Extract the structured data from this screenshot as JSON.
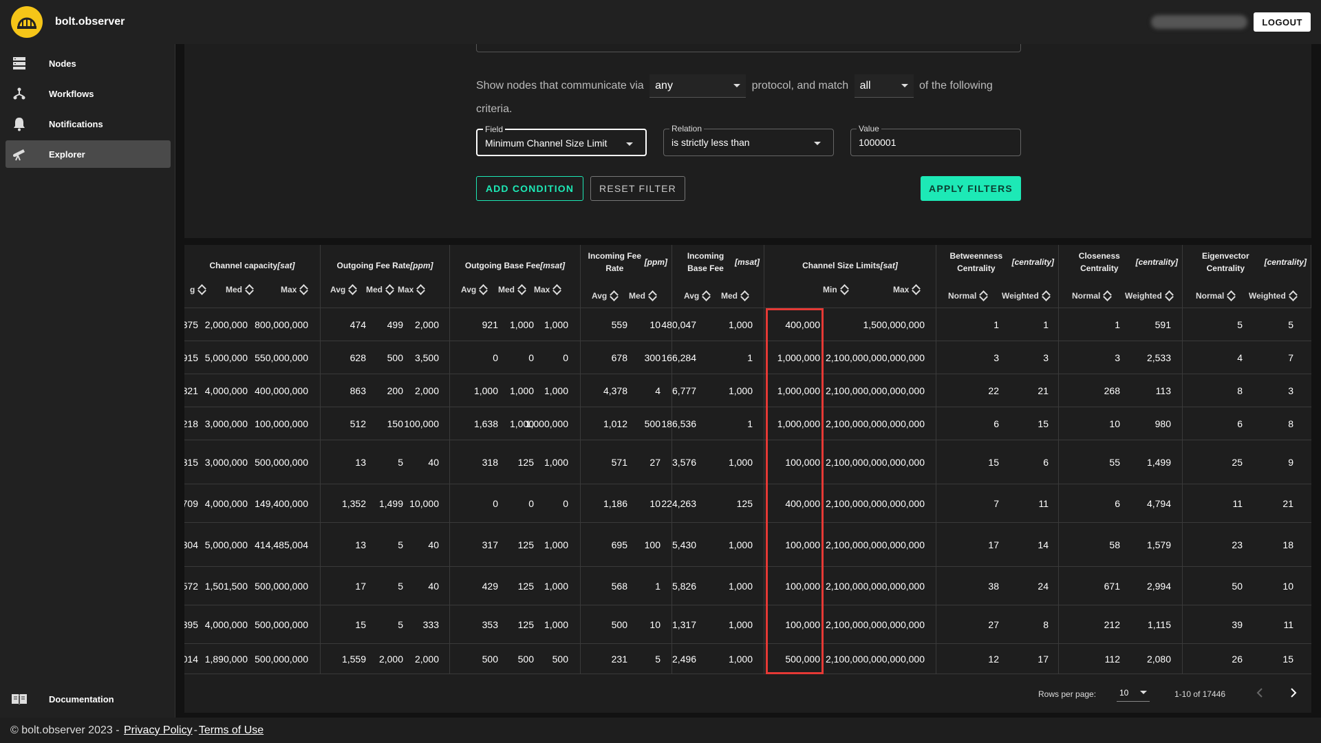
{
  "app": {
    "brand": "bolt.observer",
    "logout_label": "LOGOUT"
  },
  "sidebar": {
    "items": [
      {
        "label": "Nodes",
        "icon": "server-icon"
      },
      {
        "label": "Workflows",
        "icon": "workflow-icon"
      },
      {
        "label": "Notifications",
        "icon": "bell-icon"
      },
      {
        "label": "Explorer",
        "icon": "telescope-icon",
        "active": true
      }
    ],
    "documentation": "Documentation"
  },
  "filter": {
    "sentence_1": "Show nodes that communicate via",
    "protocol": "any",
    "sentence_2": "protocol, and match",
    "match": "all",
    "sentence_3": "of the following criteria.",
    "field_label": "Field",
    "field_value": "Minimum Channel Size Limit",
    "relation_label": "Relation",
    "relation_value": "is strictly less than",
    "value_label": "Value",
    "value_value": "1000001",
    "add_condition": "ADD CONDITION",
    "reset_filter": "RESET FILTER",
    "apply_filters": "APPLY FILTERS"
  },
  "table": {
    "groups": [
      {
        "title": "Channel capacity",
        "unit": "[sat]",
        "subs": [
          "g",
          "Med",
          "Max"
        ]
      },
      {
        "title": "Outgoing Fee Rate",
        "unit": "[ppm]",
        "subs": [
          "Avg",
          "Med",
          "Max"
        ]
      },
      {
        "title": "Outgoing Base Fee",
        "unit": "[msat]",
        "subs": [
          "Avg",
          "Med",
          "Max"
        ]
      },
      {
        "title": "Incoming Fee Rate",
        "unit": "[ppm]",
        "subs": [
          "Avg",
          "Med"
        ]
      },
      {
        "title": "Incoming Base Fee",
        "unit": "[msat]",
        "subs": [
          "Avg",
          "Med"
        ]
      },
      {
        "title": "Channel Size Limits",
        "unit": "[sat]",
        "subs": [
          "Min",
          "Max"
        ]
      },
      {
        "title": "Betweenness Centrality",
        "unit": "[centrality]",
        "subs": [
          "Normal",
          "Weighted"
        ]
      },
      {
        "title": "Closeness Centrality",
        "unit": "[centrality]",
        "subs": [
          "Normal",
          "Weighted"
        ]
      },
      {
        "title": "Eigenvector Centrality",
        "unit": "[centrality]",
        "subs": [
          "Normal",
          "Weighted"
        ]
      }
    ],
    "rows": [
      [
        "375",
        "2,000,000",
        "800,000,000",
        "474",
        "499",
        "2,000",
        "921",
        "1,000",
        "1,000",
        "559",
        "10",
        "480,047",
        "1,000",
        "400,000",
        "1,500,000,000",
        "1",
        "1",
        "1",
        "591",
        "5",
        "5"
      ],
      [
        "915",
        "5,000,000",
        "550,000,000",
        "628",
        "500",
        "3,500",
        "0",
        "0",
        "0",
        "678",
        "300",
        "166,284",
        "1",
        "1,000,000",
        "2,100,000,000,000,000",
        "3",
        "3",
        "3",
        "2,533",
        "4",
        "7"
      ],
      [
        "321",
        "4,000,000",
        "400,000,000",
        "863",
        "200",
        "2,000",
        "1,000",
        "1,000",
        "1,000",
        "4,378",
        "4",
        "6,777",
        "1,000",
        "1,000,000",
        "2,100,000,000,000,000",
        "22",
        "21",
        "268",
        "113",
        "8",
        "3"
      ],
      [
        "218",
        "3,000,000",
        "100,000,000",
        "512",
        "150",
        "100,000",
        "1,638",
        "1,000",
        "1,000,000",
        "1,012",
        "500",
        "186,536",
        "1",
        "1,000,000",
        "2,100,000,000,000,000",
        "6",
        "15",
        "10",
        "980",
        "6",
        "8"
      ],
      [
        "315",
        "3,000,000",
        "500,000,000",
        "13",
        "5",
        "40",
        "318",
        "125",
        "1,000",
        "571",
        "27",
        "3,576",
        "1,000",
        "100,000",
        "2,100,000,000,000,000",
        "15",
        "6",
        "55",
        "1,499",
        "25",
        "9"
      ],
      [
        "709",
        "4,000,000",
        "149,400,000",
        "1,352",
        "1,499",
        "10,000",
        "0",
        "0",
        "0",
        "1,186",
        "10",
        "224,263",
        "125",
        "400,000",
        "2,100,000,000,000,000",
        "7",
        "11",
        "6",
        "4,794",
        "11",
        "21"
      ],
      [
        "304",
        "5,000,000",
        "414,485,004",
        "13",
        "5",
        "40",
        "317",
        "125",
        "1,000",
        "695",
        "100",
        "5,430",
        "1,000",
        "100,000",
        "2,100,000,000,000,000",
        "17",
        "14",
        "58",
        "1,579",
        "23",
        "18"
      ],
      [
        "572",
        "1,501,500",
        "500,000,000",
        "17",
        "5",
        "40",
        "429",
        "125",
        "1,000",
        "568",
        "1",
        "5,826",
        "1,000",
        "100,000",
        "2,100,000,000,000,000",
        "38",
        "24",
        "671",
        "2,994",
        "50",
        "10"
      ],
      [
        "395",
        "4,000,000",
        "500,000,000",
        "15",
        "5",
        "333",
        "353",
        "125",
        "1,000",
        "500",
        "10",
        "1,317",
        "1,000",
        "100,000",
        "2,100,000,000,000,000",
        "27",
        "8",
        "212",
        "1,115",
        "39",
        "11"
      ],
      [
        "014",
        "1,890,000",
        "500,000,000",
        "1,559",
        "2,000",
        "2,000",
        "500",
        "500",
        "500",
        "231",
        "5",
        "2,496",
        "1,000",
        "500,000",
        "2,100,000,000,000,000",
        "12",
        "17",
        "112",
        "2,080",
        "26",
        "15"
      ]
    ]
  },
  "pagination": {
    "rows_per_page_label": "Rows per page:",
    "rows_per_page": "10",
    "range": "1-10 of 17446"
  },
  "footer": {
    "copyright": "© bolt.observer 2023 -",
    "privacy": "Privacy Policy ",
    "separator": "-",
    "terms": "Terms of Use"
  }
}
